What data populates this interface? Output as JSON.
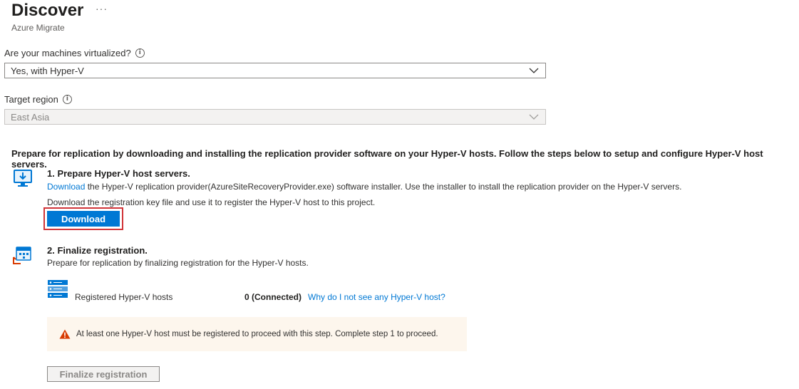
{
  "header": {
    "title": "Discover",
    "more": "···",
    "subtitle": "Azure Migrate"
  },
  "virtualized": {
    "label": "Are your machines virtualized?",
    "value": "Yes, with Hyper-V"
  },
  "region": {
    "label": "Target region",
    "value": "East Asia"
  },
  "intro": "Prepare for replication by downloading and installing the replication provider software on your Hyper-V hosts. Follow the steps below to setup and configure Hyper-V host servers.",
  "step1": {
    "title": "1. Prepare Hyper-V host servers.",
    "download_link": "Download",
    "installer_text": " the Hyper-V replication provider(AzureSiteRecoveryProvider.exe) software installer. Use the installer to install the replication provider on the Hyper-V servers.",
    "key_text": "Download the registration key file and use it to register the Hyper-V host to this project.",
    "download_button": "Download"
  },
  "step2": {
    "title": "2. Finalize registration.",
    "text": "Prepare for replication by finalizing registration for the Hyper-V hosts.",
    "hosts_label": "Registered Hyper-V hosts",
    "hosts_count": "0 (Connected)",
    "hosts_link": "Why do I not see any Hyper-V host?",
    "warning": "At least one Hyper-V host must be registered to proceed with this step. Complete step 1 to proceed.",
    "finalize_button": "Finalize registration"
  },
  "colors": {
    "accent": "#0078d4",
    "highlight": "#d13438",
    "warning_bg": "#fdf6ed",
    "warning_icon": "#d83b01"
  }
}
